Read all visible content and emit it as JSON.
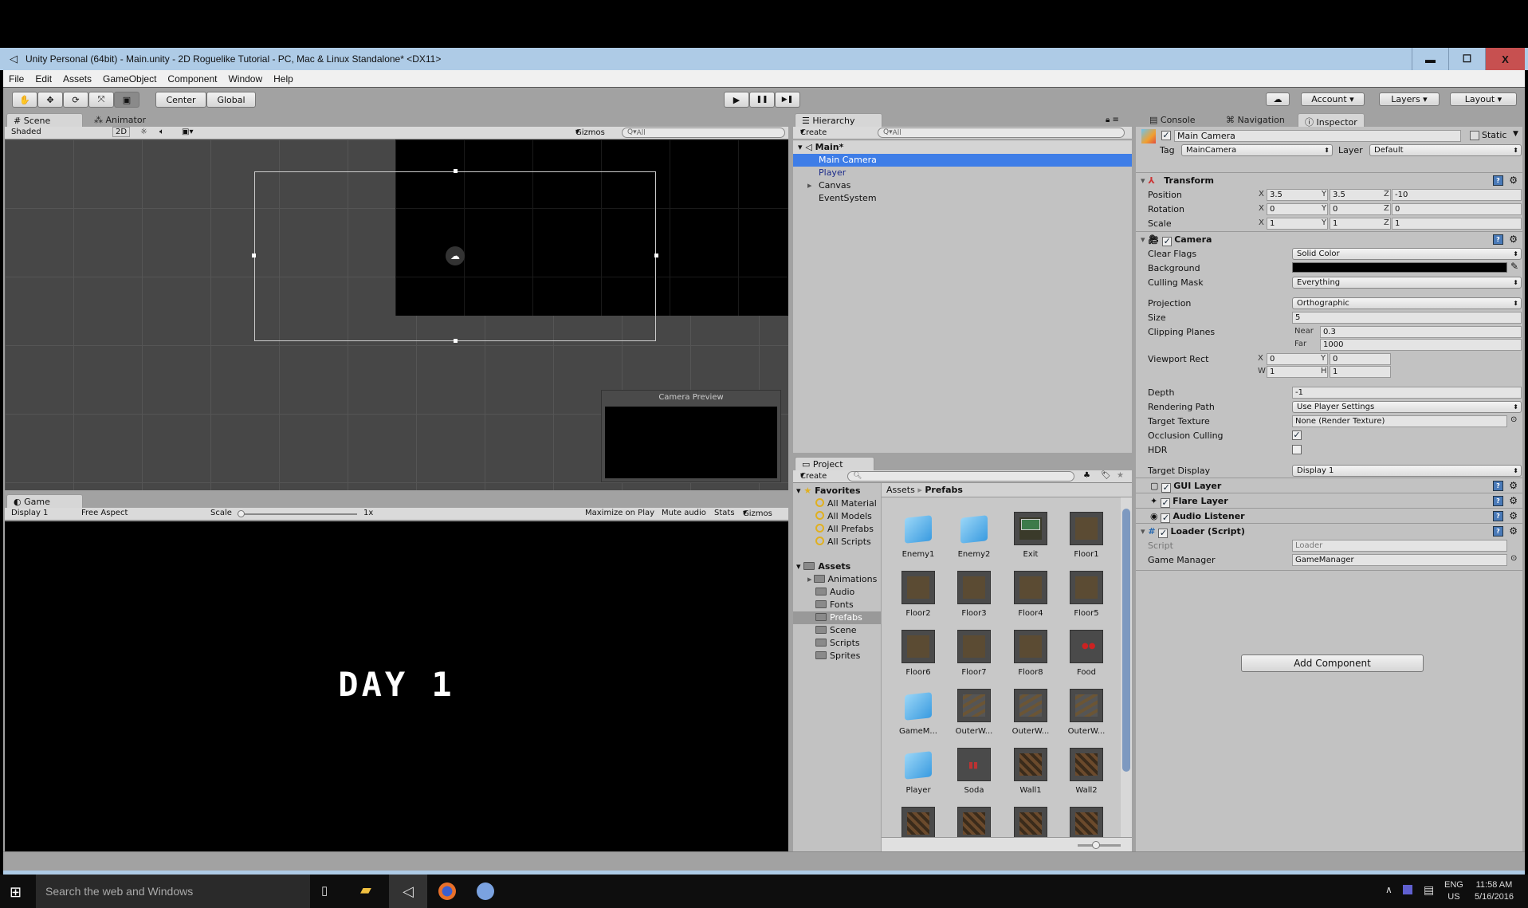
{
  "window": {
    "title": "Unity Personal (64bit) - Main.unity - 2D Roguelike Tutorial - PC, Mac & Linux Standalone* <DX11>",
    "minimize": "▬",
    "maximize": "☐",
    "close": "X",
    "close_color": "#c75050"
  },
  "menu": [
    "File",
    "Edit",
    "Assets",
    "GameObject",
    "Component",
    "Window",
    "Help"
  ],
  "toolbar": {
    "tools": [
      "hand-tool",
      "move-tool",
      "rotate-tool",
      "scale-tool",
      "rect-tool"
    ],
    "active_tool": "rect-tool",
    "pivot": "Center",
    "space": "Global",
    "play": "▶",
    "pause": "❚❚",
    "step": "▶❚",
    "cloud": "☁",
    "account": "Account",
    "layers": "Layers",
    "layout": "Layout"
  },
  "scene": {
    "tabs": [
      "Scene",
      "Animator"
    ],
    "shading": "Shaded",
    "mode_2d": "2D",
    "gizmos": "Gizmos",
    "search_placeholder": "All",
    "camera_preview": "Camera Preview"
  },
  "game": {
    "tab": "Game",
    "display": "Display 1",
    "aspect": "Free Aspect",
    "scale_label": "Scale",
    "scale_value": "1x",
    "maximize": "Maximize on Play",
    "mute": "Mute audio",
    "stats": "Stats",
    "gizmos": "Gizmos",
    "text": "DAY 1"
  },
  "hierarchy": {
    "tab": "Hierarchy",
    "create": "Create",
    "search_placeholder": "All",
    "scene": "Main*",
    "items": [
      {
        "label": "Main Camera",
        "selected": true
      },
      {
        "label": "Player",
        "prefab": true
      },
      {
        "label": "Canvas",
        "expandable": true
      },
      {
        "label": "EventSystem"
      }
    ]
  },
  "project": {
    "tab": "Project",
    "create": "Create",
    "favorites": {
      "label": "Favorites",
      "items": [
        "All Material",
        "All Models",
        "All Prefabs",
        "All Scripts"
      ]
    },
    "assets": {
      "label": "Assets",
      "items": [
        "Animations",
        "Audio",
        "Fonts",
        "Prefabs",
        "Scene",
        "Scripts",
        "Sprites"
      ],
      "selected": "Prefabs"
    },
    "breadcrumb": [
      "Assets",
      "Prefabs"
    ],
    "prefabs": [
      {
        "name": "Enemy1",
        "type": "cube"
      },
      {
        "name": "Enemy2",
        "type": "cube"
      },
      {
        "name": "Exit",
        "type": "exit"
      },
      {
        "name": "Floor1",
        "type": "floor"
      },
      {
        "name": "Floor2",
        "type": "floor"
      },
      {
        "name": "Floor3",
        "type": "floor"
      },
      {
        "name": "Floor4",
        "type": "floor"
      },
      {
        "name": "Floor5",
        "type": "floor"
      },
      {
        "name": "Floor6",
        "type": "floor"
      },
      {
        "name": "Floor7",
        "type": "floor"
      },
      {
        "name": "Floor8",
        "type": "floor"
      },
      {
        "name": "Food",
        "type": "food"
      },
      {
        "name": "GameM...",
        "type": "cube"
      },
      {
        "name": "OuterW...",
        "type": "outer"
      },
      {
        "name": "OuterW...",
        "type": "outer"
      },
      {
        "name": "OuterW...",
        "type": "outer"
      },
      {
        "name": "Player",
        "type": "cube"
      },
      {
        "name": "Soda",
        "type": "soda"
      },
      {
        "name": "Wall1",
        "type": "wall"
      },
      {
        "name": "Wall2",
        "type": "wall"
      },
      {
        "name": "",
        "type": "wall"
      },
      {
        "name": "",
        "type": "wall"
      },
      {
        "name": "",
        "type": "wall"
      },
      {
        "name": "",
        "type": "wall"
      }
    ]
  },
  "inspector": {
    "tabs": [
      "Console",
      "Navigation",
      "Inspector"
    ],
    "active_tab": "Inspector",
    "object_name": "Main Camera",
    "static": "Static",
    "tag_label": "Tag",
    "tag": "MainCamera",
    "layer_label": "Layer",
    "layer": "Default",
    "transform": {
      "title": "Transform",
      "position": {
        "label": "Position",
        "x": "3.5",
        "y": "3.5",
        "z": "-10"
      },
      "rotation": {
        "label": "Rotation",
        "x": "0",
        "y": "0",
        "z": "0"
      },
      "scale": {
        "label": "Scale",
        "x": "1",
        "y": "1",
        "z": "1"
      }
    },
    "camera": {
      "title": "Camera",
      "clear_flags": {
        "label": "Clear Flags",
        "value": "Solid Color"
      },
      "background": {
        "label": "Background",
        "color": "#000000"
      },
      "culling_mask": {
        "label": "Culling Mask",
        "value": "Everything"
      },
      "projection": {
        "label": "Projection",
        "value": "Orthographic"
      },
      "size": {
        "label": "Size",
        "value": "5"
      },
      "clipping": {
        "label": "Clipping Planes",
        "near_label": "Near",
        "near": "0.3",
        "far_label": "Far",
        "far": "1000"
      },
      "viewport": {
        "label": "Viewport Rect",
        "x": "0",
        "y": "0",
        "w": "1",
        "h": "1"
      },
      "depth": {
        "label": "Depth",
        "value": "-1"
      },
      "rendering_path": {
        "label": "Rendering Path",
        "value": "Use Player Settings"
      },
      "target_texture": {
        "label": "Target Texture",
        "value": "None (Render Texture)"
      },
      "occlusion": {
        "label": "Occlusion Culling",
        "checked": true
      },
      "hdr": {
        "label": "HDR",
        "checked": false
      },
      "target_display": {
        "label": "Target Display",
        "value": "Display 1"
      }
    },
    "components": [
      "GUI Layer",
      "Flare Layer",
      "Audio Listener"
    ],
    "loader": {
      "title": "Loader (Script)",
      "script_label": "Script",
      "script": "Loader",
      "gm_label": "Game Manager",
      "gm": "GameManager"
    },
    "add_component": "Add Component"
  },
  "taskbar": {
    "search": "Search the web and Windows",
    "lang1": "ENG",
    "lang2": "US",
    "time": "11:58 AM",
    "date": "5/16/2016"
  }
}
